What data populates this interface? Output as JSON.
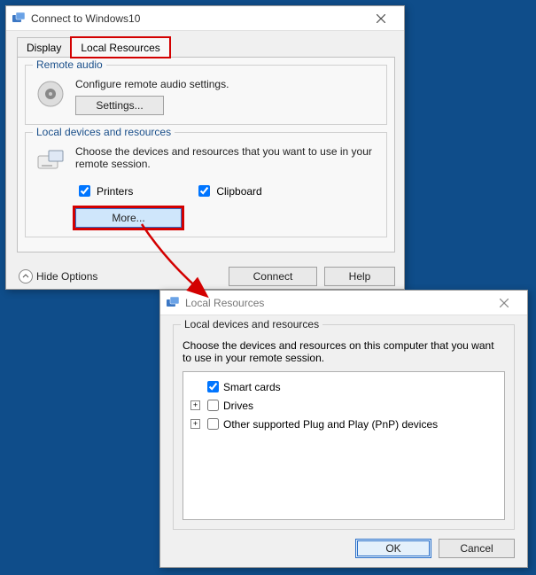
{
  "window1": {
    "title": "Connect to Windows10",
    "tabs": {
      "display": "Display",
      "local_resources": "Local Resources"
    },
    "remote_audio": {
      "legend": "Remote audio",
      "desc": "Configure remote audio settings.",
      "settings_btn": "Settings..."
    },
    "local_devices": {
      "legend": "Local devices and resources",
      "desc": "Choose the devices and resources that you want to use in your remote session.",
      "printers": "Printers",
      "clipboard": "Clipboard",
      "more_btn": "More..."
    },
    "hide_options": "Hide Options",
    "connect_btn": "Connect",
    "help_btn": "Help"
  },
  "window2": {
    "title": "Local Resources",
    "group_legend": "Local devices and resources",
    "desc": "Choose the devices and resources on this computer that you want to use in your remote session.",
    "items": {
      "smart_cards": "Smart cards",
      "drives": "Drives",
      "pnp": "Other supported Plug and Play (PnP) devices"
    },
    "ok_btn": "OK",
    "cancel_btn": "Cancel"
  }
}
